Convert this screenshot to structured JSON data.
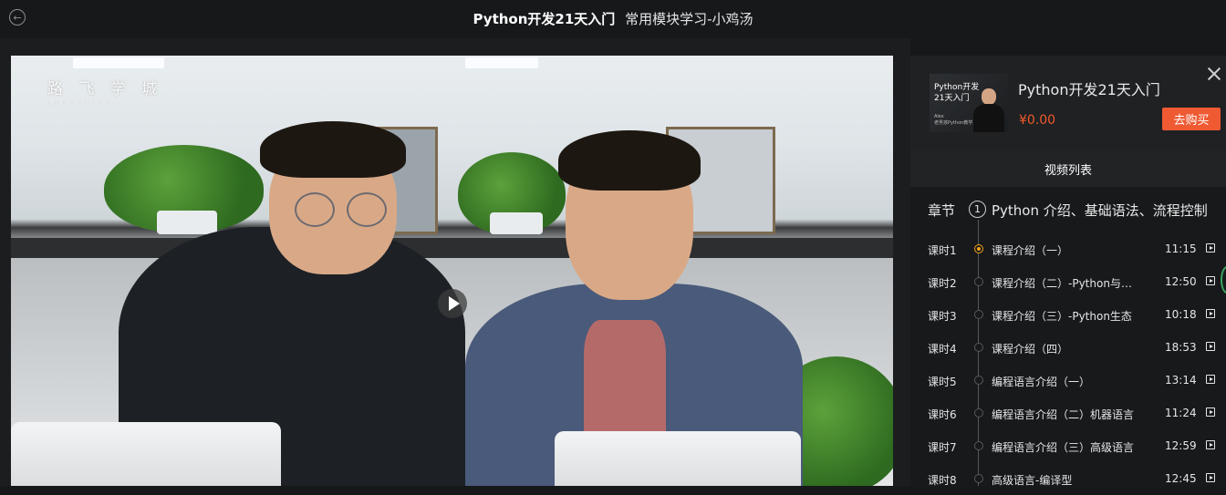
{
  "header": {
    "course_title": "Python开发21天入门",
    "lesson_title": "常用模块学习-小鸡汤"
  },
  "player": {
    "watermark_cn": "路 飞 学 城",
    "watermark_en": "LUFFYCITY"
  },
  "course_card": {
    "thumb_title": "Python开发\n21天入门",
    "thumb_sub": "Alex\n老男孩Python教学总监",
    "title": "Python开发21天入门",
    "price": "¥0.00",
    "buy_label": "去购买"
  },
  "list_tab": {
    "label": "视频列表"
  },
  "chapter": {
    "label": "章节",
    "number": "1",
    "title": "Python 介绍、基础语法、流程控制"
  },
  "lessons": [
    {
      "num": "课时1",
      "name": "课程介绍（一）",
      "duration": "11:15",
      "active": true
    },
    {
      "num": "课时2",
      "name": "课程介绍（二）-Python与其他语言",
      "duration": "12:50",
      "active": false
    },
    {
      "num": "课时3",
      "name": "课程介绍（三）-Python生态",
      "duration": "10:18",
      "active": false
    },
    {
      "num": "课时4",
      "name": "课程介绍（四）",
      "duration": "18:53",
      "active": false
    },
    {
      "num": "课时5",
      "name": "编程语言介绍（一）",
      "duration": "13:14",
      "active": false
    },
    {
      "num": "课时6",
      "name": "编程语言介绍（二）机器语言",
      "duration": "11:24",
      "active": false
    },
    {
      "num": "课时7",
      "name": "编程语言介绍（三）高级语言",
      "duration": "12:59",
      "active": false
    },
    {
      "num": "课时8",
      "name": "高级语言-编译型",
      "duration": "12:45",
      "active": false
    }
  ],
  "colors": {
    "accent": "#ef5a33",
    "active_dot": "#f7a21a",
    "background": "#16181a"
  },
  "icons": {
    "back": "back-arrow-icon",
    "close": "close-icon",
    "play": "play-icon",
    "lesson_play": "play-square-icon"
  }
}
